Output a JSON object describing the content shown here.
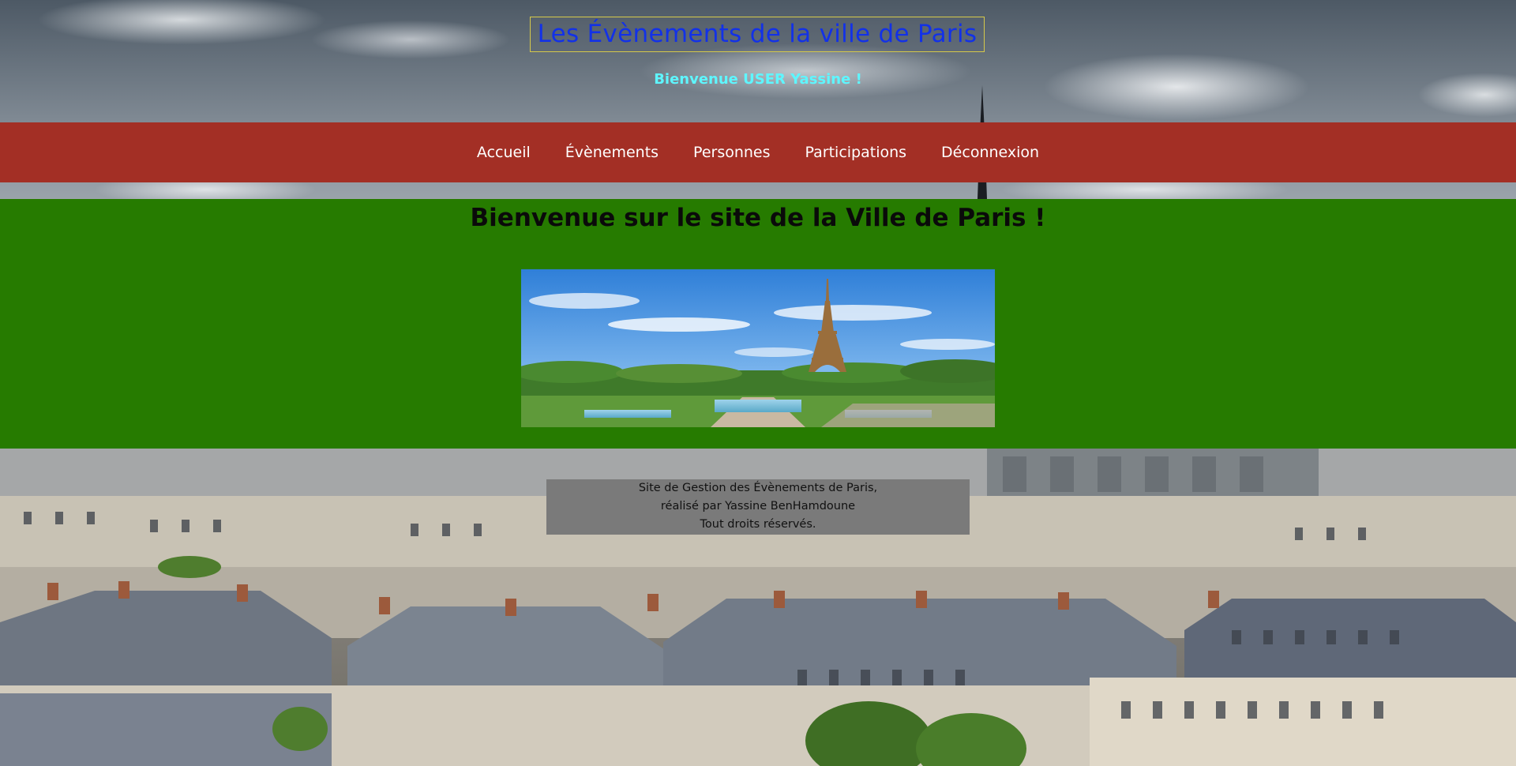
{
  "header": {
    "site_title": "Les Évènements de la ville de Paris",
    "welcome_user": "Bienvenue USER Yassine !"
  },
  "nav": {
    "items": [
      {
        "label": "Accueil"
      },
      {
        "label": "Évènements"
      },
      {
        "label": "Personnes"
      },
      {
        "label": "Participations"
      },
      {
        "label": "Déconnexion"
      }
    ]
  },
  "main": {
    "title": "Bienvenue sur le site de la Ville de Paris !"
  },
  "footer": {
    "line1": "Site de Gestion des Évènements de Paris,",
    "line2": "réalisé par Yassine BenHamdoune",
    "line3": "Tout droits réservés."
  },
  "colors": {
    "title_text": "#1231e8",
    "welcome_text": "#5ef6ff",
    "navbar_bg": "#a32f25",
    "main_bg": "#267b00",
    "footer_bg": "#7a7a7a"
  }
}
